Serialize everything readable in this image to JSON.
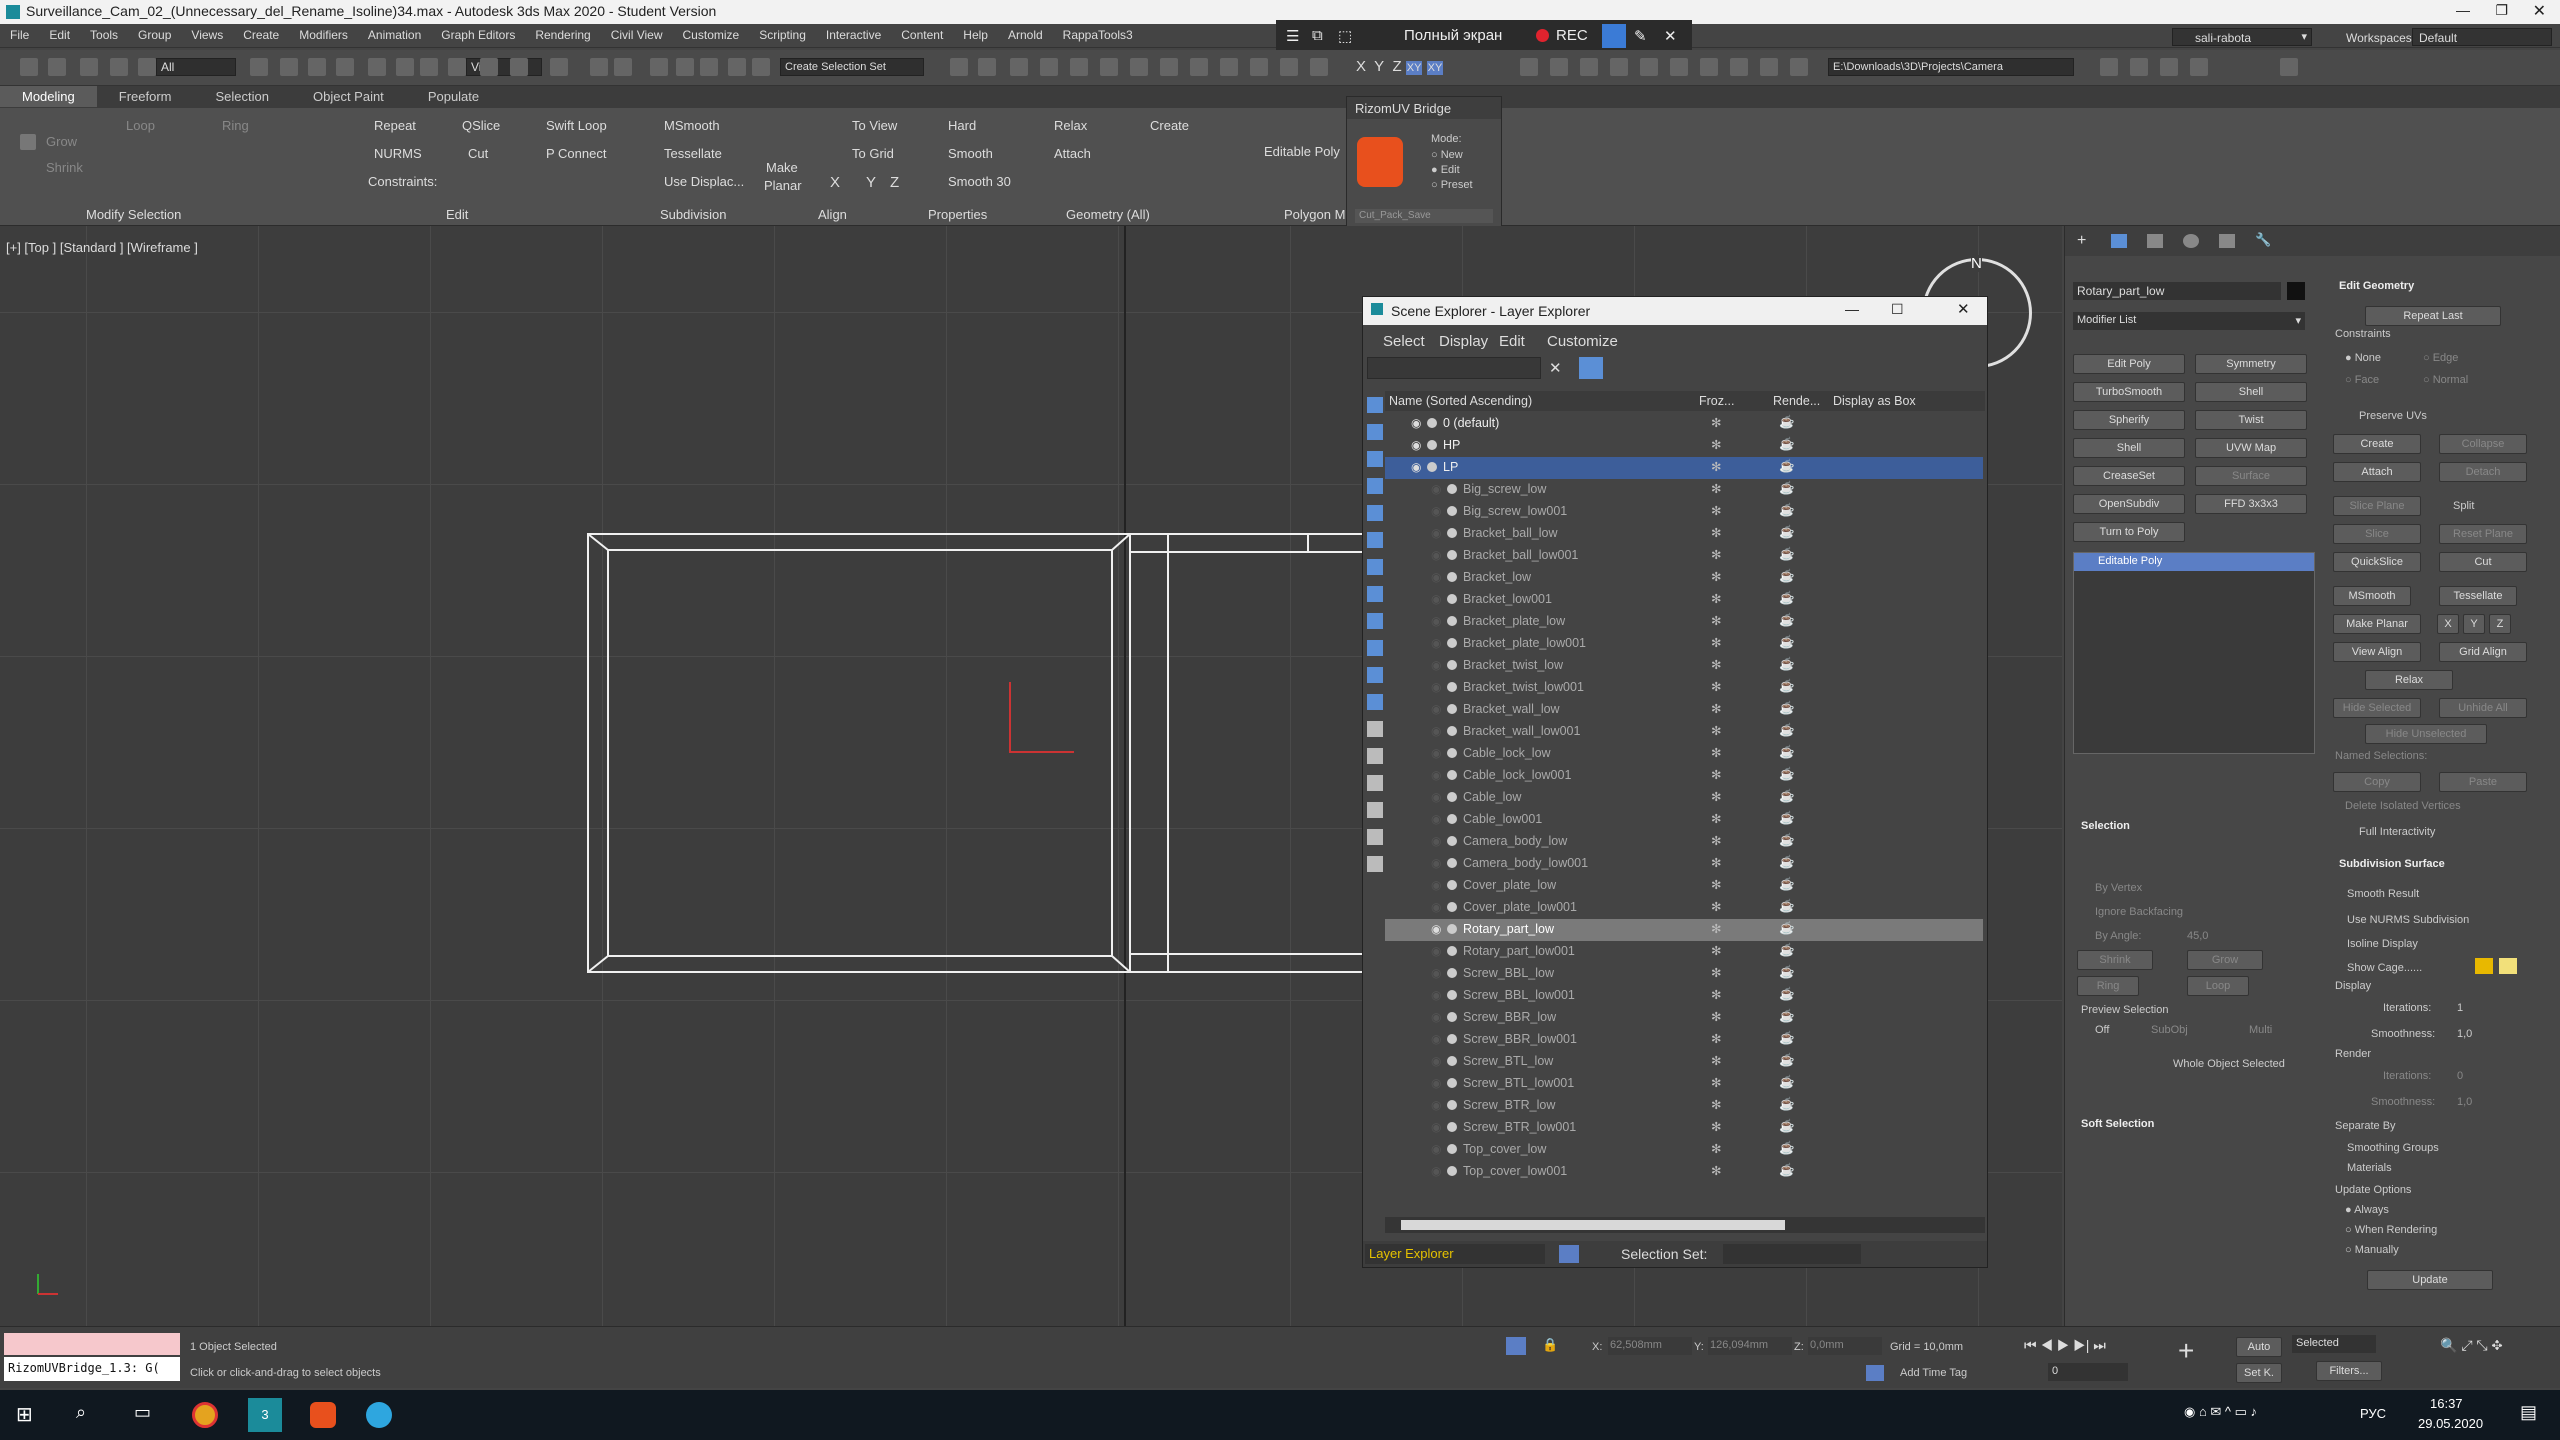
{
  "window": {
    "title": "Surveillance_Cam_02_(Unnecessary_del_Rename_Isoline)34.max - Autodesk 3ds Max 2020 - Student Version"
  },
  "recorder": {
    "fullscreen": "Полный экран",
    "rec": "REC"
  },
  "user": {
    "name": "sali-rabota",
    "workspaces_label": "Workspaces:",
    "workspace": "Default"
  },
  "menu": [
    "File",
    "Edit",
    "Tools",
    "Group",
    "Views",
    "Create",
    "Modifiers",
    "Animation",
    "Graph Editors",
    "Rendering",
    "Civil View",
    "Customize",
    "Scripting",
    "Interactive",
    "Content",
    "Help",
    "Arnold",
    "RappaTools3"
  ],
  "toolbar": {
    "filter": "All",
    "refcoord": "View",
    "selset": "Create Selection Set",
    "path": "E:\\Downloads\\3D\\Projects\\Camera",
    "axes": [
      "X",
      "Y",
      "Z",
      "XY",
      "XY"
    ]
  },
  "ribbon": {
    "tabs": [
      "Modeling",
      "Freeform",
      "Selection",
      "Object Paint",
      "Populate"
    ],
    "modify_selection": {
      "grow": "Grow",
      "shrink": "Shrink",
      "loop": "Loop",
      "ring": "Ring",
      "group_label": "Modify Selection"
    },
    "edit": {
      "repeat": "Repeat",
      "qslice": "QSlice",
      "swift_loop": "Swift Loop",
      "nurms": "NURMS",
      "cut": "Cut",
      "p_connect": "P Connect",
      "constraints": "Constraints:",
      "group_label": "Edit"
    },
    "subdivision": {
      "msmooth": "MSmooth",
      "tessellate": "Tessellate",
      "use_displac": "Use Displac...",
      "group_label": "Subdivision"
    },
    "align": {
      "make_planar_1": "Make",
      "make_planar_2": "Planar",
      "to_view": "To View",
      "to_grid": "To Grid",
      "x": "X",
      "y": "Y",
      "z": "Z",
      "group_label": "Align"
    },
    "properties": {
      "hard": "Hard",
      "smooth": "Smooth",
      "smooth30": "Smooth 30",
      "group_label": "Properties"
    },
    "geometry": {
      "relax": "Relax",
      "create": "Create",
      "attach": "Attach",
      "group_label": "Geometry (All)"
    },
    "polygon": {
      "editable_poly": "Editable Poly",
      "group_label": "Polygon M"
    }
  },
  "rizom": {
    "title": "RizomUV Bridge",
    "mode_label": "Mode:",
    "modes": [
      "New",
      "Edit",
      "Preset"
    ],
    "preset": "Cut_Pack_Save"
  },
  "viewport": {
    "label": "[+] [Top ] [Standard ] [Wireframe ]",
    "compass": "N"
  },
  "explorer": {
    "title": "Scene Explorer - Layer Explorer",
    "menu": [
      "Select",
      "Display",
      "Edit",
      "Customize"
    ],
    "columns": [
      "Name (Sorted Ascending)",
      "Froz...",
      "Rende...",
      "Display as Box"
    ],
    "layers": [
      "0 (default)",
      "HP",
      "LP"
    ],
    "objects": [
      "Big_screw_low",
      "Big_screw_low001",
      "Bracket_ball_low",
      "Bracket_ball_low001",
      "Bracket_low",
      "Bracket_low001",
      "Bracket_plate_low",
      "Bracket_plate_low001",
      "Bracket_twist_low",
      "Bracket_twist_low001",
      "Bracket_wall_low",
      "Bracket_wall_low001",
      "Cable_lock_low",
      "Cable_lock_low001",
      "Cable_low",
      "Cable_low001",
      "Camera_body_low",
      "Camera_body_low001",
      "Cover_plate_low",
      "Cover_plate_low001",
      "Rotary_part_low",
      "Rotary_part_low001",
      "Screw_BBL_low",
      "Screw_BBL_low001",
      "Screw_BBR_low",
      "Screw_BBR_low001",
      "Screw_BTL_low",
      "Screw_BTL_low001",
      "Screw_BTR_low",
      "Screw_BTR_low001",
      "Top_cover_low",
      "Top_cover_low001"
    ],
    "selected_object": "Rotary_part_low",
    "footer_explorer": "Layer Explorer",
    "footer_selset": "Selection Set:"
  },
  "command_panel": {
    "object_name": "Rotary_part_low",
    "modifier_list": "Modifier List",
    "buttons": [
      "Edit Poly",
      "Symmetry",
      "TurboSmooth",
      "Shell",
      "Spherify",
      "Twist",
      "Shell",
      "UVW Map",
      "CreaseSet",
      "Surface",
      "OpenSubdiv",
      "FFD 3x3x3",
      "Turn to Poly"
    ],
    "stack_item": "Editable Poly",
    "selection": {
      "title": "Selection",
      "by_vertex": "By Vertex",
      "ignore_backfacing": "Ignore Backfacing",
      "by_angle": "By Angle:",
      "angle": "45,0",
      "shrink": "Shrink",
      "grow": "Grow",
      "ring": "Ring",
      "loop": "Loop",
      "preview": "Preview Selection",
      "off": "Off",
      "subobj": "SubObj",
      "multi": "Multi",
      "whole": "Whole Object Selected"
    },
    "soft_selection": "Soft Selection",
    "edit_geometry": {
      "title": "Edit Geometry",
      "repeat_last": "Repeat Last",
      "constraints": "Constraints",
      "none": "None",
      "edge": "Edge",
      "face": "Face",
      "normal": "Normal",
      "preserve_uvs": "Preserve UVs",
      "create": "Create",
      "collapse": "Collapse",
      "attach": "Attach",
      "detach": "Detach",
      "slice_plane": "Slice Plane",
      "split": "Split",
      "slice": "Slice",
      "reset_plane": "Reset Plane",
      "quickslice": "QuickSlice",
      "cut": "Cut",
      "msmooth": "MSmooth",
      "tessellate": "Tessellate",
      "make_planar": "Make Planar",
      "x": "X",
      "y": "Y",
      "z": "Z",
      "view_align": "View Align",
      "grid_align": "Grid Align",
      "relax": "Relax",
      "hide_selected": "Hide Selected",
      "unhide_all": "Unhide All",
      "hide_unselected": "Hide Unselected",
      "named_selections": "Named Selections:",
      "copy": "Copy",
      "paste": "Paste",
      "delete_isolated": "Delete Isolated Vertices",
      "full_interactivity": "Full Interactivity"
    },
    "subdivision_surface": {
      "title": "Subdivision Surface",
      "smooth_result": "Smooth Result",
      "use_nurms": "Use NURMS Subdivision",
      "isoline": "Isoline Display",
      "show_cage": "Show Cage......",
      "display": "Display",
      "iterations": "Iterations:",
      "iter_val": "1",
      "smoothness": "Smoothness:",
      "smooth_val": "1,0",
      "render": "Render",
      "r_iterations": "Iterations:",
      "r_iter_val": "0",
      "r_smoothness": "Smoothness:",
      "r_smooth_val": "1,0",
      "separate_by": "Separate By",
      "smoothing_groups": "Smoothing Groups",
      "materials": "Materials",
      "update_options": "Update Options",
      "always": "Always",
      "when_rendering": "When Rendering",
      "manually": "Manually",
      "update": "Update"
    }
  },
  "status": {
    "maxscript": "RizomUVBridge_1.3: G(",
    "selected": "1 Object Selected",
    "prompt": "Click or click-and-drag to select objects",
    "x_label": "X:",
    "x": "62,508mm",
    "y_label": "Y:",
    "y": "126,094mm",
    "z_label": "Z:",
    "z": "0,0mm",
    "grid": "Grid = 10,0mm",
    "add_time_tag": "Add Time Tag",
    "auto": "Auto",
    "set_k": "Set K.",
    "selected_dd": "Selected",
    "filters": "Filters...",
    "frame": "0"
  },
  "taskbar": {
    "lang": "РУС",
    "time": "16:37",
    "date": "29.05.2020"
  }
}
